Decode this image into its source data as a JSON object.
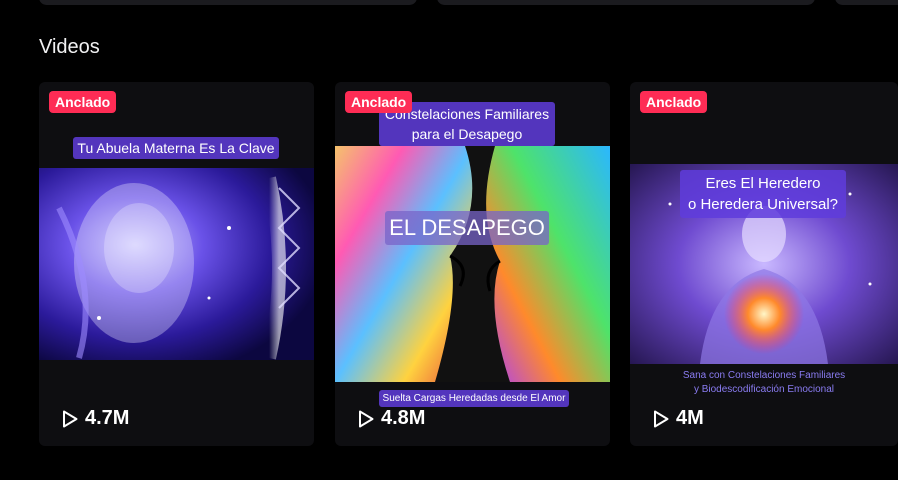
{
  "section": {
    "title": "Videos"
  },
  "videos": [
    {
      "badge": "Anclado",
      "caption_top": "Tu Abuela Materna Es La Clave",
      "views": "4.7M",
      "icon": "play-icon"
    },
    {
      "badge": "Anclado",
      "caption_top_line1": "Constelaciones Familiares",
      "caption_top_line2": "para el Desapego",
      "caption_center": "EL DESAPEGO",
      "caption_bottom": "Suelta Cargas Heredadas desde El Amor",
      "views": "4.8M",
      "icon": "play-icon"
    },
    {
      "badge": "Anclado",
      "caption_top_line1": "Eres El Heredero",
      "caption_top_line2": "o Heredera Universal?",
      "caption_bottom_line1": "Sana con Constelaciones Familiares",
      "caption_bottom_line2": "y Biodescodificación Emocional",
      "views": "4M",
      "icon": "play-icon"
    }
  ],
  "colors": {
    "badge": "#fe2c55",
    "background": "#000000",
    "card": "#0e0e11"
  }
}
